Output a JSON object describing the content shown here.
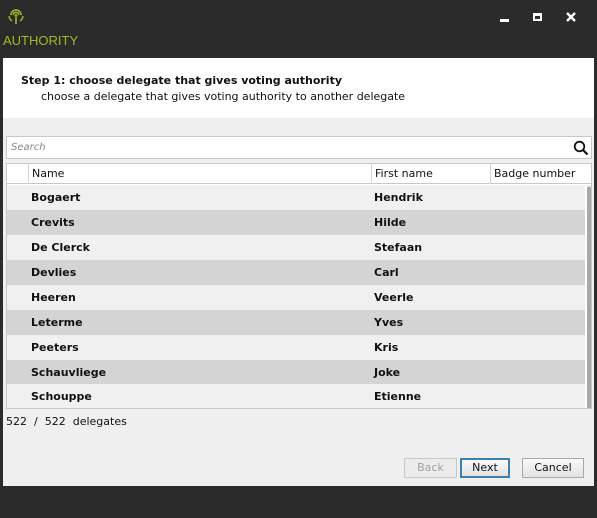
{
  "window": {
    "title": "AUTHORITY",
    "icon": "broadcast-icon",
    "accent_color": "#9bbd1e",
    "controls": [
      "minimize-icon",
      "maximize-icon",
      "close-icon"
    ]
  },
  "step": {
    "title": "Step 1: choose delegate that gives voting authority",
    "subtitle": "choose a delegate that gives voting authority to another delegate"
  },
  "search": {
    "placeholder": "Search",
    "value": "",
    "icon": "search-icon"
  },
  "table": {
    "columns": [
      "Name",
      "First name",
      "Badge number"
    ],
    "rows": [
      {
        "name": "Bogaert",
        "first_name": "Hendrik",
        "badge": ""
      },
      {
        "name": "Crevits",
        "first_name": "Hilde",
        "badge": ""
      },
      {
        "name": "De Clerck",
        "first_name": "Stefaan",
        "badge": ""
      },
      {
        "name": "Devlies",
        "first_name": "Carl",
        "badge": ""
      },
      {
        "name": "Heeren",
        "first_name": "Veerle",
        "badge": ""
      },
      {
        "name": "Leterme",
        "first_name": "Yves",
        "badge": ""
      },
      {
        "name": "Peeters",
        "first_name": "Kris",
        "badge": ""
      },
      {
        "name": "Schauvliege",
        "first_name": "Joke",
        "badge": ""
      },
      {
        "name": "Schouppe",
        "first_name": "Etienne",
        "badge": ""
      }
    ]
  },
  "count": {
    "shown": "522",
    "separator": "/",
    "total": "522",
    "label": "delegates"
  },
  "buttons": {
    "back": "Back",
    "next": "Next",
    "cancel": "Cancel"
  }
}
